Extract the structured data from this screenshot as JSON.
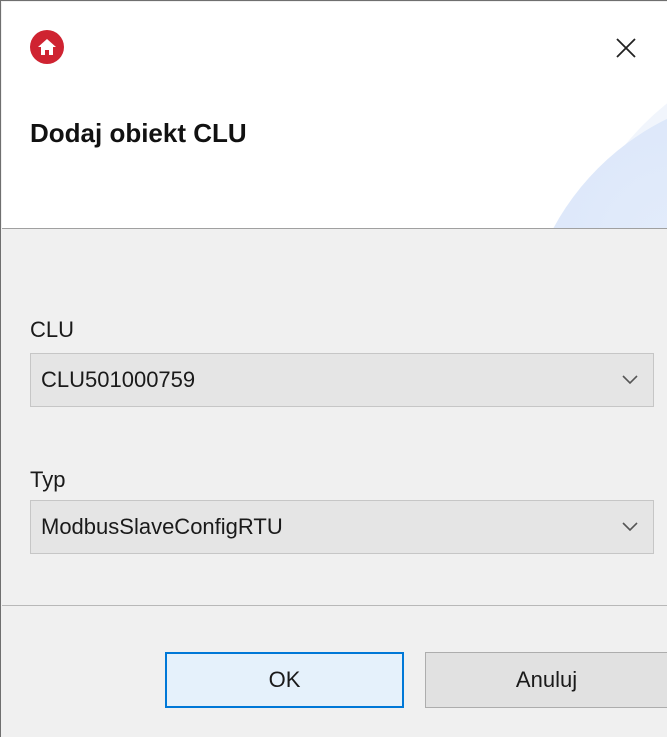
{
  "window": {
    "title": "Dodaj obiekt CLU",
    "app_icon": "home-icon",
    "close_icon": "close-icon"
  },
  "form": {
    "clu": {
      "label": "CLU",
      "value": "CLU501000759"
    },
    "typ": {
      "label": "Typ",
      "value": "ModbusSlaveConfigRTU"
    }
  },
  "buttons": {
    "ok_label": "OK",
    "cancel_label": "Anuluj"
  },
  "colors": {
    "brand_red": "#cf2331",
    "focus_blue": "#0078d7"
  }
}
